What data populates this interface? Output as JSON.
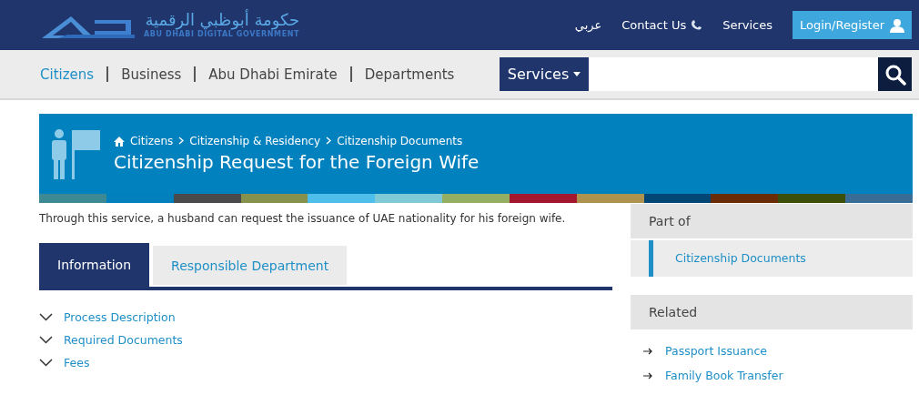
{
  "header": {
    "logo_arabic": "حكومة أبوظبي الرقمية",
    "logo_english": "ABU DHABI DIGITAL GOVERNMENT",
    "links": [
      {
        "label": "عربي",
        "kind": "text"
      },
      {
        "label": "Contact Us",
        "kind": "phone"
      },
      {
        "label": "Services",
        "kind": "text"
      }
    ],
    "login": "Login/Register"
  },
  "nav": {
    "items": [
      {
        "label": "Citizens",
        "selected": true
      },
      {
        "label": "Business",
        "selected": false
      },
      {
        "label": "Abu Dhabi Emirate",
        "selected": false
      },
      {
        "label": "Departments",
        "selected": false
      }
    ],
    "search_scope": "Services"
  },
  "banner": {
    "breadcrumb": [
      "Citizens",
      "Citizenship & Residency",
      "Citizenship Documents"
    ],
    "title": "Citizenship Request for the Foreign Wife"
  },
  "description": "Through this service, a husband can request the issuance of UAE nationality for his foreign wife.",
  "tabs": [
    {
      "label": "Information",
      "selected": true
    },
    {
      "label": "Responsible Department",
      "selected": false
    }
  ],
  "sections": [
    {
      "label": "Process Description",
      "expanded": false
    },
    {
      "label": "Required Documents",
      "expanded": false
    },
    {
      "label": "Fees",
      "expanded": false
    }
  ],
  "sidebar": {
    "part_of": {
      "title": "Part of",
      "items": [
        "Citizenship Documents"
      ]
    },
    "related": {
      "title": "Related",
      "items": [
        "Passport Issuance",
        "Family Book Transfer"
      ]
    }
  }
}
